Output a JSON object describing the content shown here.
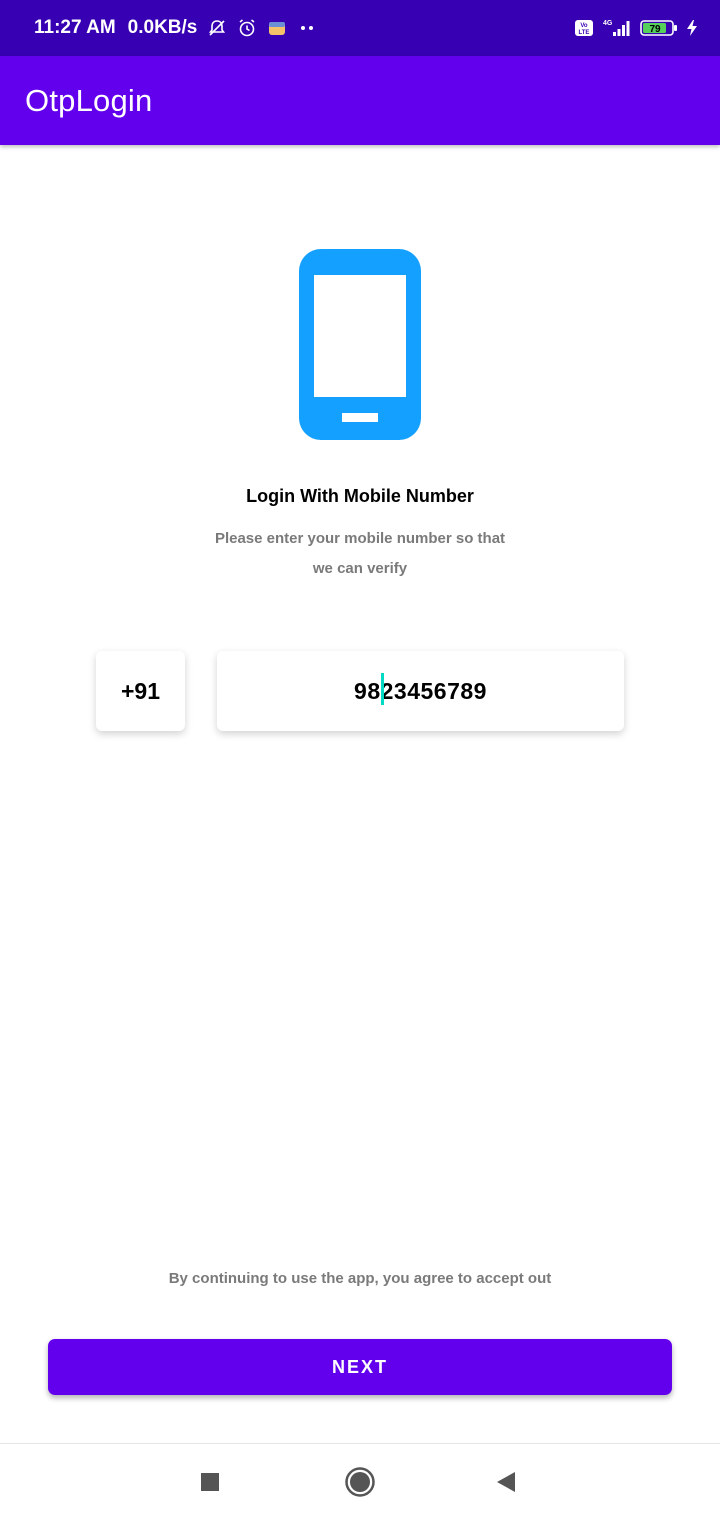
{
  "status_bar": {
    "time": "11:27 AM",
    "net_speed": "0.0KB/s",
    "icons_left": [
      "notifications-off-icon",
      "alarm-icon",
      "app-notification-icon",
      "more-dots-icon"
    ],
    "icons_right": [
      "volte-icon",
      "signal-4g-icon",
      "battery-icon",
      "charging-icon"
    ],
    "network_type": "4G",
    "battery_level": "79"
  },
  "app_bar": {
    "title": "OtpLogin"
  },
  "main": {
    "illustration": "mobile-phone-icon",
    "heading": "Login With Mobile Number",
    "subtext_line1": "Please enter your mobile number so that",
    "subtext_line2": "we can verify",
    "country_code": "+91",
    "phone_number": "9823456789",
    "terms_text": "By continuing to use the app, you agree to accept out",
    "next_label": "NEXT"
  },
  "colors": {
    "status_bar": "#3700b3",
    "primary": "#6200ee",
    "illustration": "#14a0fe",
    "caret": "#03dac5"
  },
  "nav_bar": {
    "buttons": [
      "recents-square-icon",
      "home-circle-icon",
      "back-triangle-icon"
    ]
  }
}
